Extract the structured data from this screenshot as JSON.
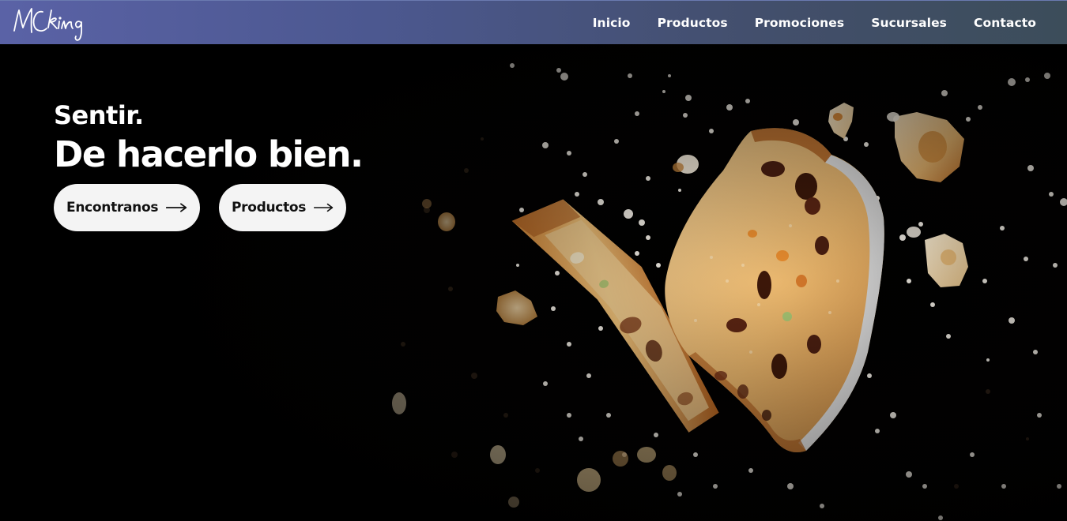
{
  "header": {
    "logo_text": "MCking",
    "nav": [
      {
        "label": "Inicio"
      },
      {
        "label": "Productos"
      },
      {
        "label": "Promociones"
      },
      {
        "label": "Sucursales"
      },
      {
        "label": "Contacto"
      }
    ]
  },
  "hero": {
    "tagline_line1": "Sentir.",
    "tagline_line2": "De hacerlo bien.",
    "buttons": [
      {
        "label": "Encontranos",
        "icon": "arrow-right-icon"
      },
      {
        "label": "Productos",
        "icon": "arrow-right-icon"
      }
    ]
  },
  "colors": {
    "nav_gradient_start": "#5a62a6",
    "nav_gradient_end": "#3c4d5a",
    "hero_background": "#000000",
    "button_background": "#f4f4f4",
    "button_text": "#111111"
  }
}
